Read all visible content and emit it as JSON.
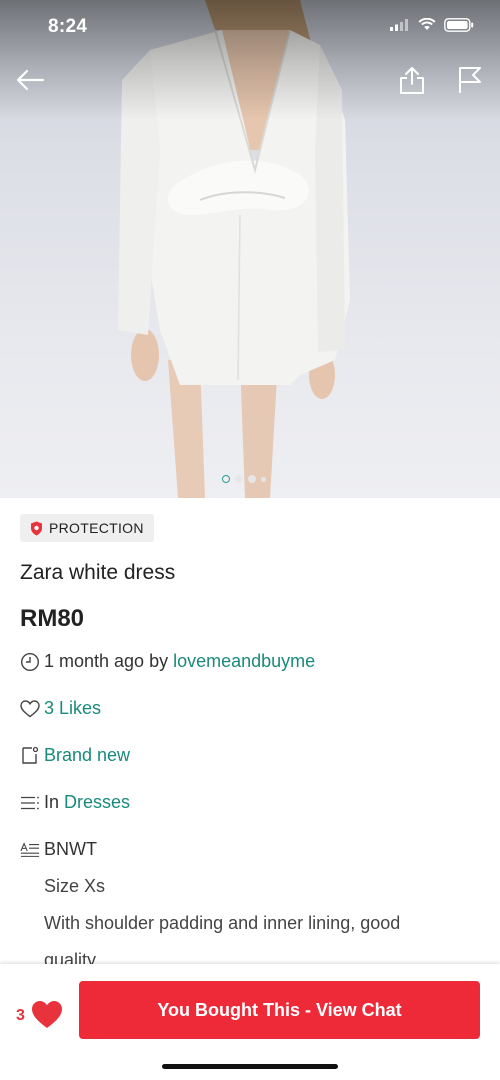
{
  "status_bar": {
    "time": "8:24"
  },
  "header": {
    "back_icon": "arrow-left-icon",
    "share_icon": "share-icon",
    "flag_icon": "flag-icon"
  },
  "gallery": {
    "image_count": 4,
    "active_index": 0
  },
  "listing": {
    "badge": "PROTECTION",
    "title": "Zara white dress",
    "price": "RM80",
    "time_ago": "1 month ago by ",
    "seller": "lovemeandbuyme",
    "likes": "3 Likes",
    "condition": "Brand new",
    "category_prefix": "In ",
    "category": "Dresses",
    "description": [
      "BNWT",
      "Size Xs",
      "With shoulder padding and inner lining, good",
      "quality"
    ]
  },
  "bottom_bar": {
    "like_count": "3",
    "cta_label": "You Bought This - View Chat"
  },
  "colors": {
    "accent_teal": "#1a8a7a",
    "cta_red": "#ee2a38",
    "heart_red": "#e8323c"
  }
}
